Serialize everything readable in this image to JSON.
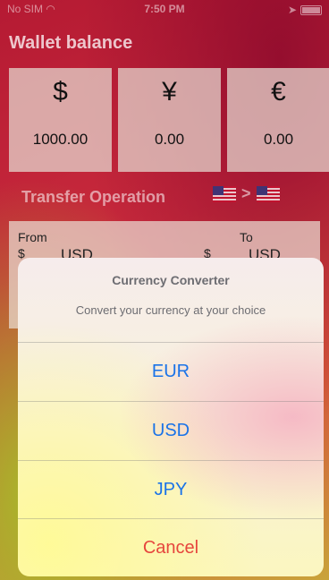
{
  "status_bar": {
    "carrier": "No SIM",
    "time": "7:50 PM"
  },
  "wallet": {
    "title": "Wallet balance",
    "cards": [
      {
        "symbol": "$",
        "amount": "1000.00"
      },
      {
        "symbol": "¥",
        "amount": "0.00"
      },
      {
        "symbol": "€",
        "amount": "0.00"
      }
    ]
  },
  "transfer": {
    "title": "Transfer Operation",
    "arrow": ">",
    "from_label": "From",
    "to_label": "To",
    "from_symbol": "$",
    "from_currency": "USD",
    "to_symbol": "$",
    "to_currency": "USD"
  },
  "action_sheet": {
    "title": "Currency Converter",
    "message": "Convert your currency at your choice",
    "actions": [
      "EUR",
      "USD",
      "JPY"
    ],
    "cancel": "Cancel",
    "action_color": "#1a73e8",
    "cancel_color": "#e6463d"
  }
}
